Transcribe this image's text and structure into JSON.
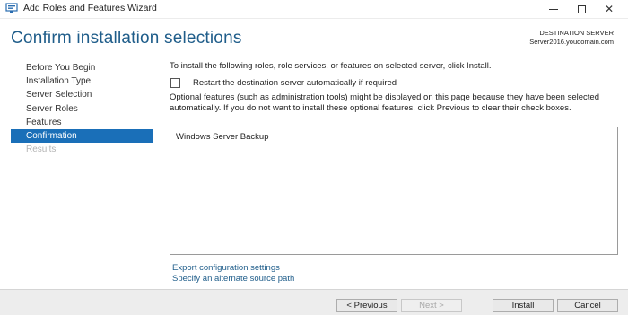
{
  "window": {
    "title": "Add Roles and Features Wizard",
    "icon": "server-manager-icon",
    "controls": {
      "minimize": "minimize-icon",
      "maximize": "maximize-icon",
      "close": "✕"
    }
  },
  "header": {
    "title": "Confirm installation selections",
    "destination_label": "DESTINATION SERVER",
    "destination_server": "Server2016.youdomain.com"
  },
  "nav": {
    "items": [
      {
        "label": "Before You Begin",
        "state": "normal"
      },
      {
        "label": "Installation Type",
        "state": "normal"
      },
      {
        "label": "Server Selection",
        "state": "normal"
      },
      {
        "label": "Server Roles",
        "state": "normal"
      },
      {
        "label": "Features",
        "state": "normal"
      },
      {
        "label": "Confirmation",
        "state": "active"
      },
      {
        "label": "Results",
        "state": "disabled"
      }
    ]
  },
  "main": {
    "intro": "To install the following roles, role services, or features on selected server, click Install.",
    "restart_checkbox": {
      "label": "Restart the destination server automatically if required",
      "checked": false
    },
    "optional_note": "Optional features (such as administration tools) might be displayed on this page because they have been selected automatically. If you do not want to install these optional features, click Previous to clear their check boxes.",
    "features": [
      "Windows Server Backup"
    ],
    "links": {
      "export": "Export configuration settings",
      "source": "Specify an alternate source path"
    }
  },
  "footer": {
    "previous": "< Previous",
    "next": "Next >",
    "install": "Install",
    "cancel": "Cancel"
  },
  "colors": {
    "accent": "#1a6fb8",
    "title": "#1f5d8a",
    "footer_bg": "#ededed"
  }
}
